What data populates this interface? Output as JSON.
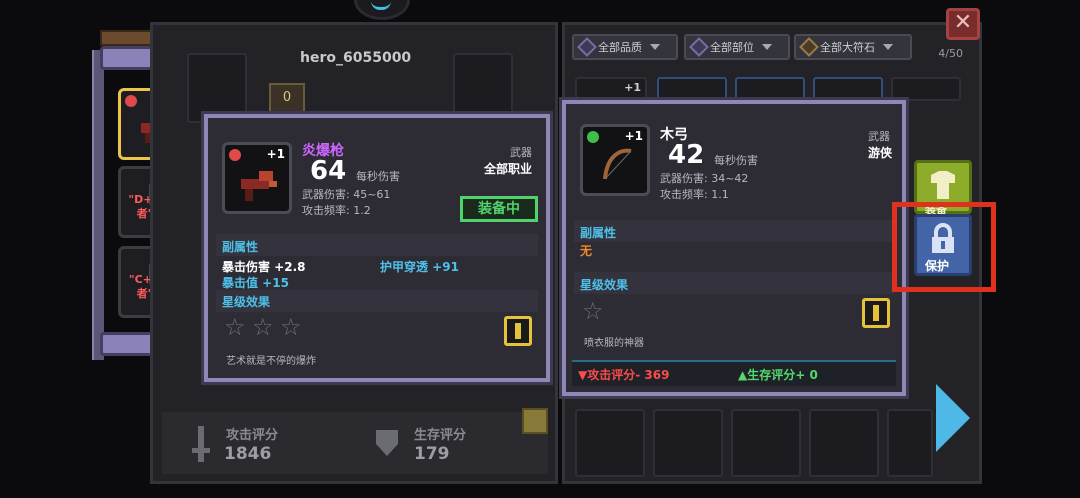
{
  "hero": {
    "name": "hero_6055000",
    "level_badge": "0"
  },
  "left_slots": [
    {
      "plus": "+1"
    },
    {
      "lock_text": "\"D++级勇者\"开启"
    },
    {
      "lock_text": "\"C++级勇者\"开启"
    }
  ],
  "scores": {
    "attack_label": "攻击评分",
    "attack_value": "1846",
    "survive_label": "生存评分",
    "survive_value": "179"
  },
  "filters": [
    {
      "label": "全部品质"
    },
    {
      "label": "全部部位"
    },
    {
      "label": "全部大符石"
    }
  ],
  "inventory_count": "4/50",
  "inventory_first_plus": "+1",
  "close_label": "✕",
  "equipped_item": {
    "name": "炎爆枪",
    "plus": "+1",
    "dps": "64",
    "dps_label": "每秒伤害",
    "damage": "武器伤害: 45~61",
    "rate": "攻击频率: 1.2",
    "type": "武器",
    "class": "全部职业",
    "status": "装备中",
    "sub_attr_label": "副属性",
    "sub_attrs": [
      {
        "text": "暴击伤害 +2.8"
      },
      {
        "text": "护甲穿透 +91"
      },
      {
        "text": "暴击值 +15"
      }
    ],
    "star_label": "星级效果",
    "flavor": "艺术就是不停的爆炸"
  },
  "compare_item": {
    "name": "木弓",
    "plus": "+1",
    "dps": "42",
    "dps_label": "每秒伤害",
    "damage": "武器伤害: 34~42",
    "rate": "攻击频率: 1.1",
    "type": "武器",
    "class": "游侠",
    "sub_attr_label": "副属性",
    "sub_attr_none": "无",
    "star_label": "星级效果",
    "flavor": "喷衣服的神器",
    "attack_delta": "▼攻击评分- 369",
    "survive_delta": "▲生存评分+ 0"
  },
  "side_actions": {
    "equip_label": "装备",
    "protect_label": "保护"
  },
  "colors": {
    "accent_blue": "#4ec0e8",
    "equip_green": "#4fd36a",
    "highlight_red": "#e0311f",
    "name_purple": "#cc66ff"
  }
}
